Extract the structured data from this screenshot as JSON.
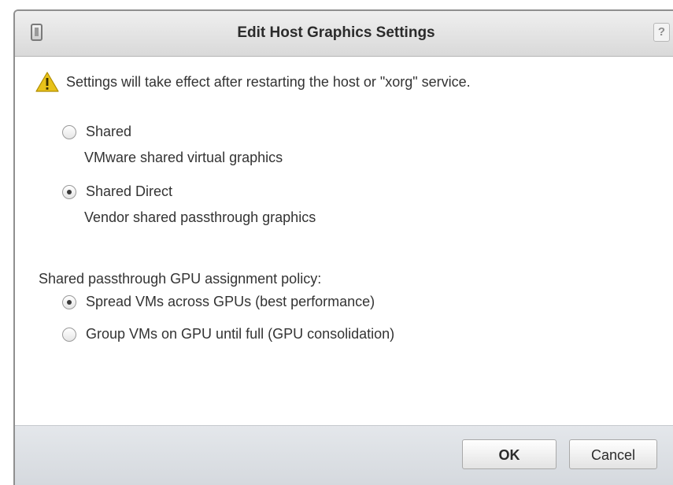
{
  "dialog": {
    "title": "Edit Host Graphics Settings",
    "help_label": "?",
    "title_icon": "host-graphics-icon"
  },
  "warning": {
    "icon": "warning-triangle-icon",
    "text": "Settings will take effect after restarting the host or \"xorg\" service."
  },
  "graphics_type": {
    "options": [
      {
        "label": "Shared",
        "description": "VMware shared virtual graphics",
        "selected": false
      },
      {
        "label": "Shared Direct",
        "description": "Vendor shared passthrough graphics",
        "selected": true
      }
    ]
  },
  "policy": {
    "label": "Shared passthrough GPU assignment policy:",
    "options": [
      {
        "label": "Spread VMs across GPUs (best performance)",
        "selected": true
      },
      {
        "label": "Group VMs on GPU until full (GPU consolidation)",
        "selected": false
      }
    ]
  },
  "buttons": {
    "ok_label": "OK",
    "cancel_label": "Cancel"
  },
  "colors": {
    "warning_icon": "#e8c21a",
    "title_bar": "#dcdcdc",
    "footer": "#dadee3"
  }
}
